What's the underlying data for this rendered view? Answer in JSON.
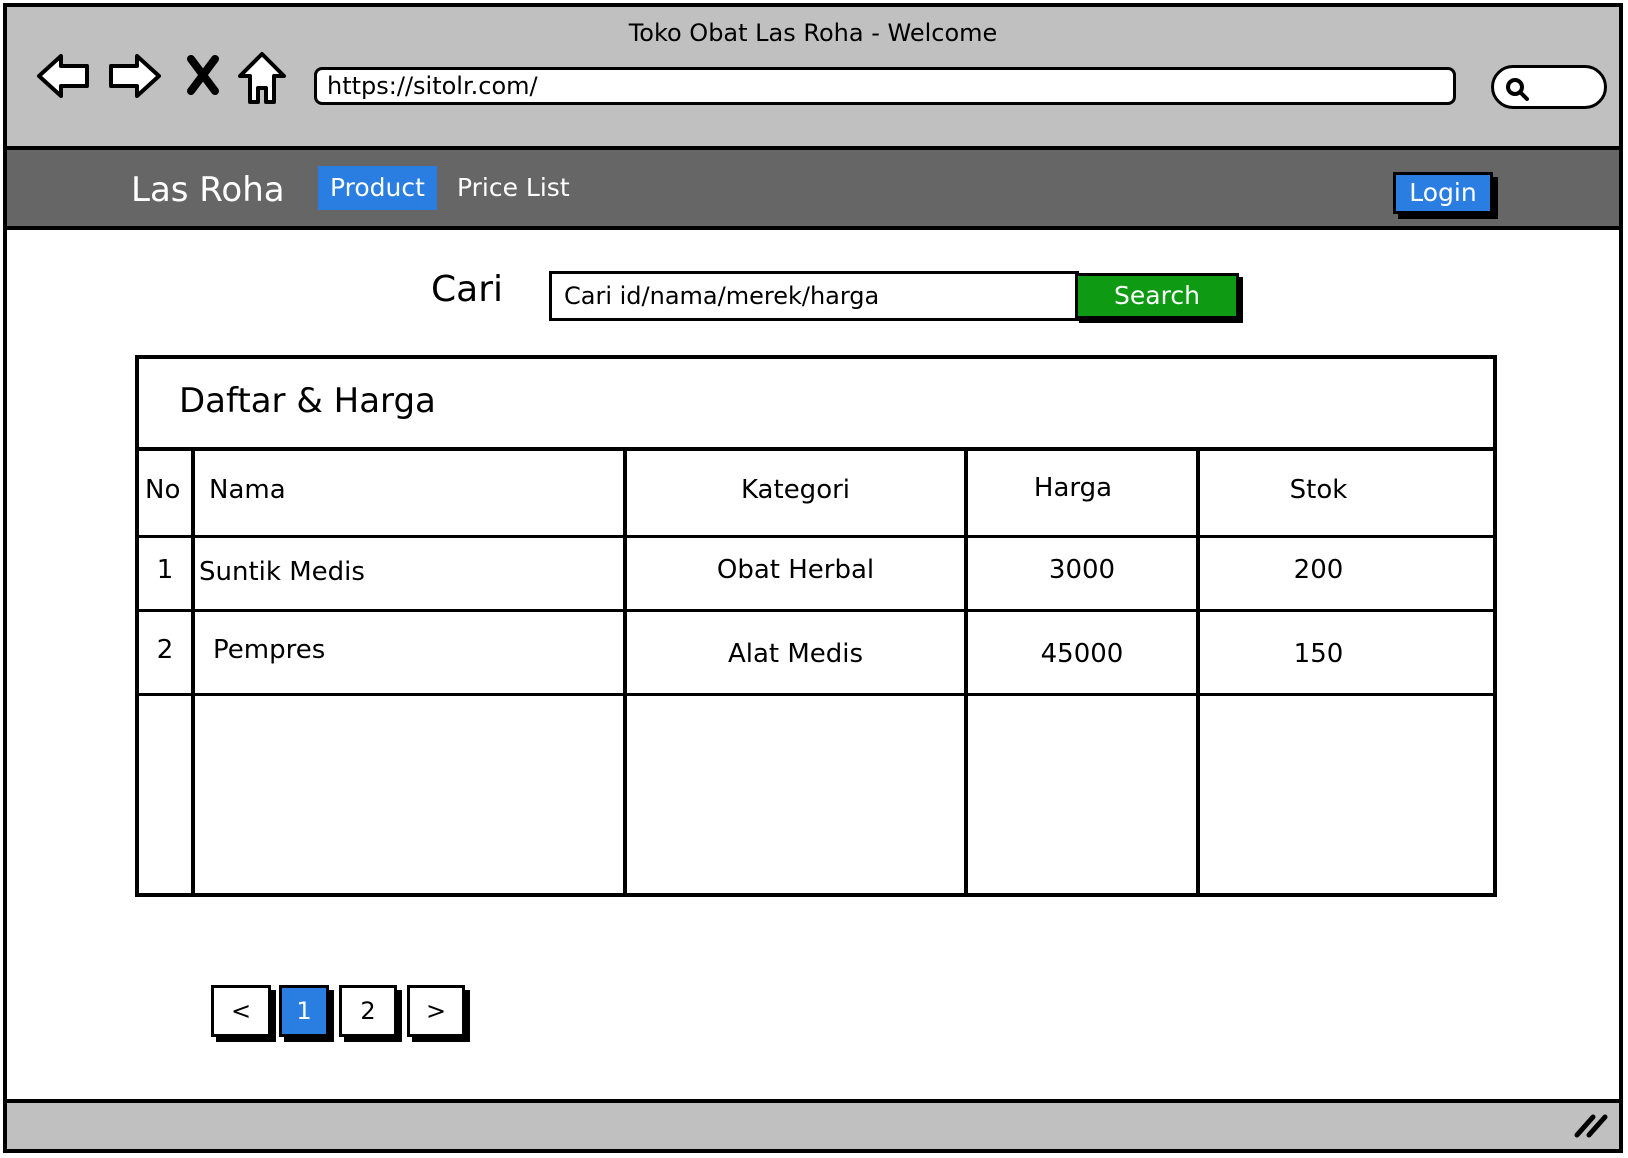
{
  "window": {
    "title": "Toko Obat Las Roha - Welcome",
    "url": "https://sitolr.com/"
  },
  "navbar": {
    "brand": "Las Roha",
    "items": [
      {
        "label": "Product",
        "active": true
      },
      {
        "label": "Price List",
        "active": false
      }
    ],
    "login_label": "Login"
  },
  "search": {
    "label": "Cari",
    "placeholder": "Cari id/nama/merek/harga",
    "button_label": "Search"
  },
  "table": {
    "title": "Daftar & Harga",
    "columns": [
      "No",
      "Nama",
      "Kategori",
      "Harga",
      "Stok"
    ],
    "rows": [
      {
        "no": "1",
        "nama": "Suntik Medis",
        "kategori": "Obat Herbal",
        "harga": "3000",
        "stok": "200"
      },
      {
        "no": "2",
        "nama": "Pempres",
        "kategori": "Alat Medis",
        "harga": "45000",
        "stok": "150"
      }
    ]
  },
  "pagination": {
    "prev": "<",
    "pages": [
      "1",
      "2"
    ],
    "current": "1",
    "next": ">"
  },
  "colors": {
    "accent": "#2a7de1",
    "search_button": "#0e9b13",
    "navbar": "#666666",
    "chrome": "#c0c0c0"
  },
  "icons": [
    "back-icon",
    "forward-icon",
    "close-icon",
    "home-icon",
    "search-icon",
    "resize-grip-icon"
  ]
}
